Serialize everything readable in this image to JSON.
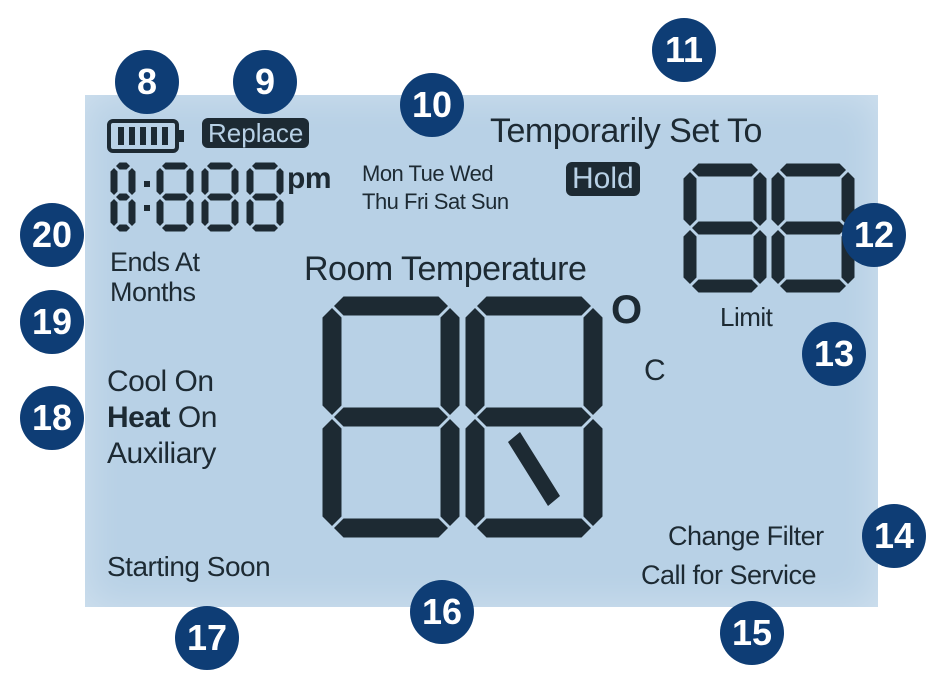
{
  "display": {
    "colors": {
      "lcd_background": "#b8d1e6",
      "segment": "#1d2a33",
      "badge": "#0e3d75",
      "badge_text": "#ffffff"
    },
    "battery_icon": "battery-icon",
    "replace_label": "Replace",
    "clock_digits": "18:88",
    "pm_label": "pm",
    "days_line1": "Mon Tue Wed",
    "days_line2": "Thu Fri Sat Sun",
    "temporarily_set_to": "Temporarily Set To",
    "hold_label": "Hold",
    "setpoint_digits": "88",
    "limit_label": "Limit",
    "ends_at": "Ends At",
    "months": "Months",
    "room_temperature": "Room Temperature",
    "room_digits": "88",
    "degree_symbol": "O",
    "unit_c": "C",
    "cool_on": "Cool On",
    "heat_word": "Heat",
    "heat_on": "On",
    "auxiliary": "Auxiliary",
    "starting_soon": "Starting Soon",
    "change_filter": "Change Filter",
    "call_for_service": "Call for Service"
  },
  "callouts": [
    "8",
    "9",
    "10",
    "11",
    "12",
    "13",
    "14",
    "15",
    "16",
    "17",
    "18",
    "19",
    "20"
  ]
}
